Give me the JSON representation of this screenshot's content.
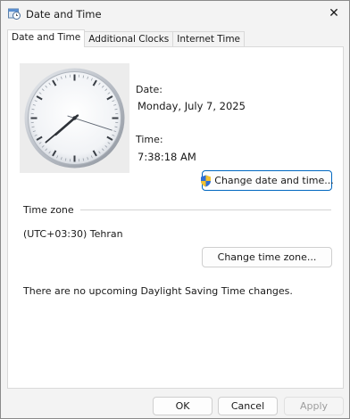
{
  "window": {
    "title": "Date and Time",
    "close_glyph": "✕",
    "icon": "date-time-control-panel-icon"
  },
  "tabs": [
    {
      "label": "Date and Time",
      "active": true
    },
    {
      "label": "Additional Clocks",
      "active": false
    },
    {
      "label": "Internet Time",
      "active": false
    }
  ],
  "date_time": {
    "date_label": "Date:",
    "date_value": "Monday, July 7, 2025",
    "time_label": "Time:",
    "time_value": "7:38:18 AM",
    "change_button": "Change date and time..."
  },
  "clock": {
    "hour": 7,
    "minute": 38,
    "second": 18
  },
  "time_zone": {
    "heading": "Time zone",
    "value": "(UTC+03:30) Tehran",
    "change_button": "Change time zone..."
  },
  "dst_message": "There are no upcoming Daylight Saving Time changes.",
  "footer": {
    "ok": "OK",
    "cancel": "Cancel",
    "apply": "Apply"
  },
  "colors": {
    "accent": "#0067c0",
    "shield_blue": "#2f6fd6",
    "shield_yellow": "#f2c230"
  }
}
